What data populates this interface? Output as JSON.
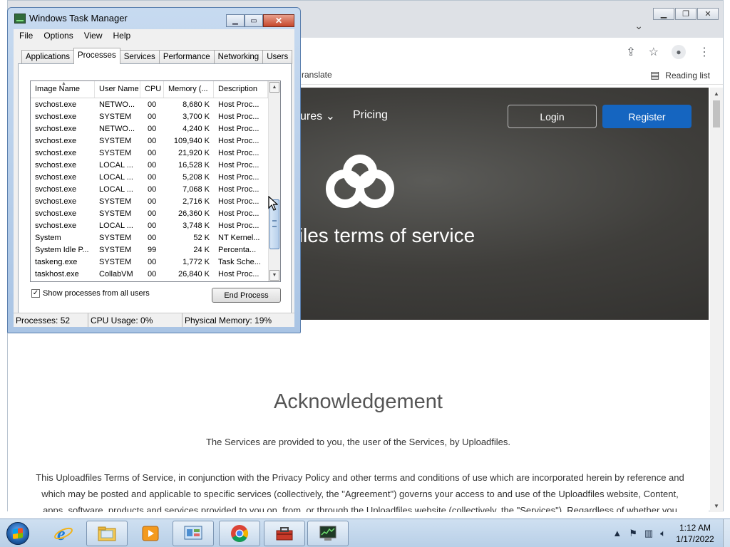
{
  "browser": {
    "bookmarks": {
      "translate": "ranslate",
      "reading_list": "Reading list"
    },
    "hero": {
      "nav_features": "ures ⌄",
      "nav_pricing": "Pricing",
      "login": "Login",
      "register": "Register",
      "title": "files terms of service"
    },
    "content": {
      "heading": "Acknowledgement",
      "intro": "The Services are provided to you, the user of the Services, by Uploadfiles.",
      "body": "This Uploadfiles Terms of Service, in conjunction with the Privacy Policy and other terms and conditions of use which are incorporated herein by reference and which may be posted and applicable to specific services (collectively, the \"Agreement\") governs your access to and use of the Uploadfiles website, Content, apps, software, products and services provided to you on, from, or through the Uploadfiles website   (collectively, the \"Services\"). Regardless of whether you have a"
    }
  },
  "taskmgr": {
    "title": "Windows Task Manager",
    "menu": [
      "File",
      "Options",
      "View",
      "Help"
    ],
    "tabs": [
      "Applications",
      "Processes",
      "Services",
      "Performance",
      "Networking",
      "Users"
    ],
    "active_tab": "Processes",
    "columns": [
      "Image Name",
      "User Name",
      "CPU",
      "Memory (...",
      "Description"
    ],
    "rows": [
      [
        "svchost.exe",
        "NETWO...",
        "00",
        "8,680 K",
        "Host Proc..."
      ],
      [
        "svchost.exe",
        "SYSTEM",
        "00",
        "3,700 K",
        "Host Proc..."
      ],
      [
        "svchost.exe",
        "NETWO...",
        "00",
        "4,240 K",
        "Host Proc..."
      ],
      [
        "svchost.exe",
        "SYSTEM",
        "00",
        "109,940 K",
        "Host Proc..."
      ],
      [
        "svchost.exe",
        "SYSTEM",
        "00",
        "21,920 K",
        "Host Proc..."
      ],
      [
        "svchost.exe",
        "LOCAL ...",
        "00",
        "16,528 K",
        "Host Proc..."
      ],
      [
        "svchost.exe",
        "LOCAL ...",
        "00",
        "5,208 K",
        "Host Proc..."
      ],
      [
        "svchost.exe",
        "LOCAL ...",
        "00",
        "7,068 K",
        "Host Proc..."
      ],
      [
        "svchost.exe",
        "SYSTEM",
        "00",
        "2,716 K",
        "Host Proc..."
      ],
      [
        "svchost.exe",
        "SYSTEM",
        "00",
        "26,360 K",
        "Host Proc..."
      ],
      [
        "svchost.exe",
        "LOCAL ...",
        "00",
        "3,748 K",
        "Host Proc..."
      ],
      [
        "System",
        "SYSTEM",
        "00",
        "52 K",
        "NT Kernel..."
      ],
      [
        "System Idle P...",
        "SYSTEM",
        "99",
        "24 K",
        "Percenta..."
      ],
      [
        "taskeng.exe",
        "SYSTEM",
        "00",
        "1,772 K",
        "Task Sche..."
      ],
      [
        "taskhost.exe",
        "CollabVM",
        "00",
        "26,840 K",
        "Host Proc..."
      ]
    ],
    "show_all_label": "Show processes from all users",
    "show_all_checked": "✓",
    "end_process": "End Process",
    "status": {
      "processes": "Processes: 52",
      "cpu": "CPU Usage: 0%",
      "memory": "Physical Memory: 19%"
    }
  },
  "taskbar": {
    "time": "1:12 AM",
    "date": "1/17/2022",
    "icons": [
      "start-orb-icon",
      "internet-explorer-icon",
      "explorer-folder-icon",
      "media-player-icon",
      "control-panel-icon",
      "chrome-icon",
      "toolbox-icon",
      "task-manager-icon"
    ]
  }
}
